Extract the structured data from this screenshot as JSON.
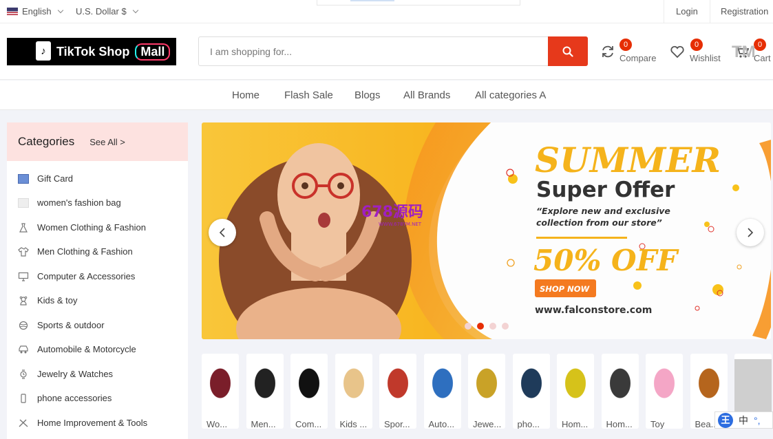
{
  "topbar": {
    "language": "English",
    "currency": "U.S. Dollar $",
    "login": "Login",
    "registration": "Registration"
  },
  "header": {
    "logo_text": "TikTok Shop",
    "logo_mall": "Mall",
    "search_placeholder": "I am shopping for...",
    "compare_label": "Compare",
    "compare_count": "0",
    "wishlist_label": "Wishlist",
    "wishlist_count": "0",
    "cart_label": "Cart",
    "cart_count": "0",
    "tm": "TM"
  },
  "nav": {
    "items": [
      "Home",
      "Flash Sale",
      "Blogs",
      "All Brands",
      "All categories A"
    ]
  },
  "categories": {
    "title": "Categories",
    "see_all": "See All >",
    "items": [
      {
        "label": "Gift Card",
        "icon": "gift-card-icon"
      },
      {
        "label": "women's fashion bag",
        "icon": "bag-icon"
      },
      {
        "label": "Women Clothing & Fashion",
        "icon": "dress-icon"
      },
      {
        "label": "Men Clothing & Fashion",
        "icon": "shirt-icon"
      },
      {
        "label": "Computer & Accessories",
        "icon": "monitor-icon"
      },
      {
        "label": "Kids & toy",
        "icon": "toy-icon"
      },
      {
        "label": "Sports & outdoor",
        "icon": "ball-icon"
      },
      {
        "label": "Automobile & Motorcycle",
        "icon": "car-icon"
      },
      {
        "label": "Jewelry & Watches",
        "icon": "watch-icon"
      },
      {
        "label": "phone accessories",
        "icon": "phone-icon"
      },
      {
        "label": "Home Improvement & Tools",
        "icon": "tools-icon"
      }
    ]
  },
  "banner": {
    "headline": "SUMMER",
    "subhead": "Super Offer",
    "tagline_1": "“Explore new and exclusive",
    "tagline_2": "collection from our store”",
    "discount": "50% OFF",
    "cta": "SHOP NOW",
    "url": "www.falconstore.com",
    "watermark": "678源码",
    "watermark_url": "WWW.678YM.NET",
    "active_slide": 2,
    "slide_count": 4
  },
  "product_categories": [
    {
      "label": "Wo...",
      "icon": "dress-product-icon",
      "color": "#7a1e2a"
    },
    {
      "label": "Men...",
      "icon": "suit-product-icon",
      "color": "#222222"
    },
    {
      "label": "Com...",
      "icon": "pc-case-product-icon",
      "color": "#111111"
    },
    {
      "label": "Kids ...",
      "icon": "baby-product-icon",
      "color": "#e8c48a"
    },
    {
      "label": "Spor...",
      "icon": "glove-product-icon",
      "color": "#c0392b"
    },
    {
      "label": "Auto...",
      "icon": "car-product-icon",
      "color": "#2e6fbf"
    },
    {
      "label": "Jewe...",
      "icon": "ring-product-icon",
      "color": "#c9a227"
    },
    {
      "label": "pho...",
      "icon": "phone-product-icon",
      "color": "#1f3b5a"
    },
    {
      "label": "Hom...",
      "icon": "toolbox-product-icon",
      "color": "#d6c21a"
    },
    {
      "label": "Hom...",
      "icon": "chair-product-icon",
      "color": "#3a3a3a"
    },
    {
      "label": "Toy",
      "icon": "toy-car-product-icon",
      "color": "#f4a6c6"
    },
    {
      "label": "Bea...",
      "icon": "lipstick-product-icon",
      "color": "#b5651d"
    },
    {
      "label": "",
      "icon": "placeholder-image-icon",
      "color": "#cccccc"
    }
  ],
  "ime": {
    "badge": "王",
    "lang": "中"
  }
}
